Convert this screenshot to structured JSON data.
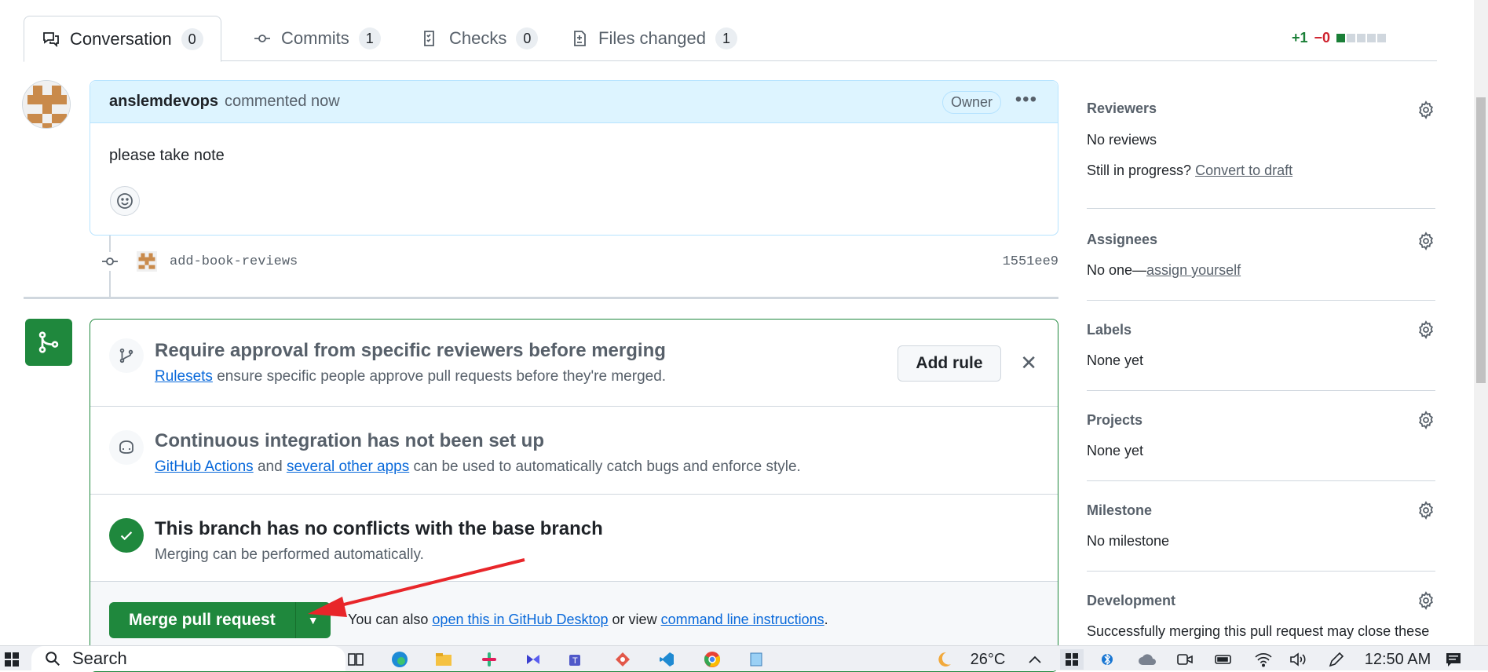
{
  "tabs": [
    {
      "label": "Conversation",
      "count": "0"
    },
    {
      "label": "Commits",
      "count": "1"
    },
    {
      "label": "Checks",
      "count": "0"
    },
    {
      "label": "Files changed",
      "count": "1"
    }
  ],
  "diffstat": {
    "plus": "+1",
    "minus": "−0"
  },
  "comment": {
    "author": "anslemdevops",
    "time": "commented now",
    "badge": "Owner",
    "body": "please take note"
  },
  "commit": {
    "message": "add-book-reviews",
    "sha": "1551ee9"
  },
  "mergebox": {
    "rule": {
      "title": "Require approval from specific reviewers before merging",
      "link": "Rulesets",
      "text": " ensure specific people approve pull requests before they're merged.",
      "button": "Add rule"
    },
    "ci": {
      "title": "Continuous integration has not been set up",
      "link1": "GitHub Actions",
      "mid": " and ",
      "link2": "several other apps",
      "text": " can be used to automatically catch bugs and enforce style."
    },
    "conflicts": {
      "title": "This branch has no conflicts with the base branch",
      "sub": "Merging can be performed automatically."
    },
    "merge": {
      "button": "Merge pull request",
      "note_pre": "You can also ",
      "link1": "open this in GitHub Desktop",
      "note_mid": " or view ",
      "link2": "command line instructions",
      "note_post": "."
    }
  },
  "sidebar": {
    "reviewers": {
      "title": "Reviewers",
      "value": "No reviews",
      "progress": "Still in progress?",
      "progress_link": "Convert to draft"
    },
    "assignees": {
      "title": "Assignees",
      "value": "No one—",
      "link": "assign yourself"
    },
    "labels": {
      "title": "Labels",
      "value": "None yet"
    },
    "projects": {
      "title": "Projects",
      "value": "None yet"
    },
    "milestone": {
      "title": "Milestone",
      "value": "No milestone"
    },
    "development": {
      "title": "Development",
      "value": "Successfully merging this pull request may close these"
    }
  },
  "taskbar": {
    "search": "Search",
    "weather": "26°C",
    "time": "12:50 AM"
  },
  "colors": {
    "merge_green": "#1f883d",
    "link_blue": "#0969da",
    "comment_header": "#ddf4ff",
    "annotation_red": "#e8262a"
  }
}
